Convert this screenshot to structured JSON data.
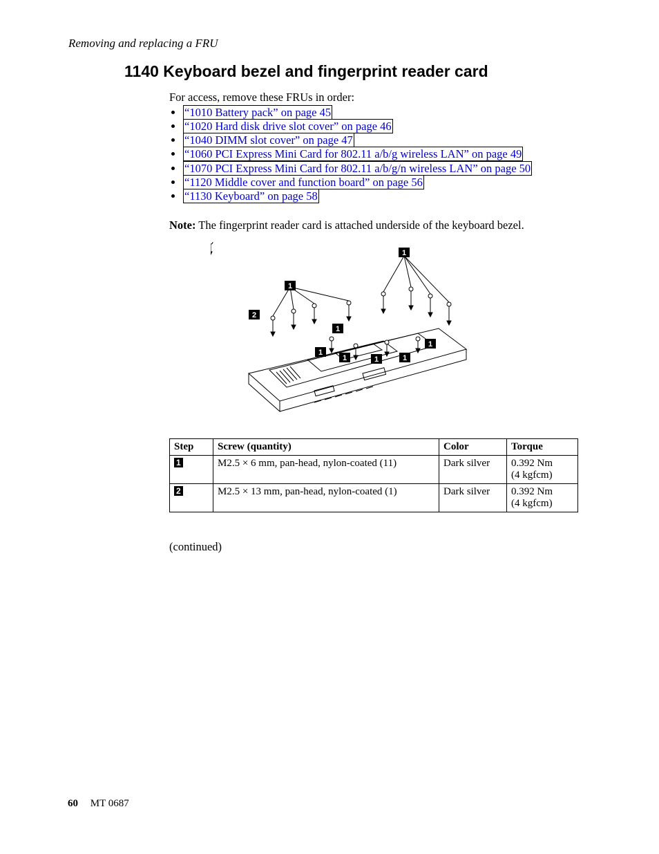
{
  "runningHead": "Removing and replacing a FRU",
  "sectionTitle": "1140 Keyboard bezel and fingerprint reader card",
  "introText": "For access, remove these FRUs in order:",
  "fruLinks": [
    "“1010 Battery pack” on page 45",
    "“1020 Hard disk drive slot cover” on page 46",
    "“1040 DIMM slot cover” on page 47",
    "“1060 PCI Express Mini Card for 802.11 a/b/g wireless LAN” on page 49",
    "“1070 PCI Express Mini Card for 802.11 a/b/g/n wireless LAN” on page 50",
    "“1120 Middle cover and function board” on page 56",
    "“1130 Keyboard” on page 58"
  ],
  "noteLabel": "Note:",
  "noteText": " The fingerprint reader card is attached underside of the keyboard bezel.",
  "table": {
    "headers": {
      "step": "Step",
      "screw": "Screw (quantity)",
      "color": "Color",
      "torque": "Torque"
    },
    "rows": [
      {
        "stepCallout": "1",
        "screw": "M2.5 × 6 mm, pan-head, nylon-coated (11)",
        "color": "Dark silver",
        "torque1": "0.392 Nm",
        "torque2": "(4 kgfcm)"
      },
      {
        "stepCallout": "2",
        "screw": "M2.5 × 13 mm, pan-head, nylon-coated (1)",
        "color": "Dark silver",
        "torque1": "0.392 Nm",
        "torque2": "(4 kgfcm)"
      }
    ]
  },
  "figureCallouts": {
    "one": "1",
    "two": "2"
  },
  "continued": "(continued)",
  "footer": {
    "pageNumber": "60",
    "docId": "MT 0687"
  }
}
